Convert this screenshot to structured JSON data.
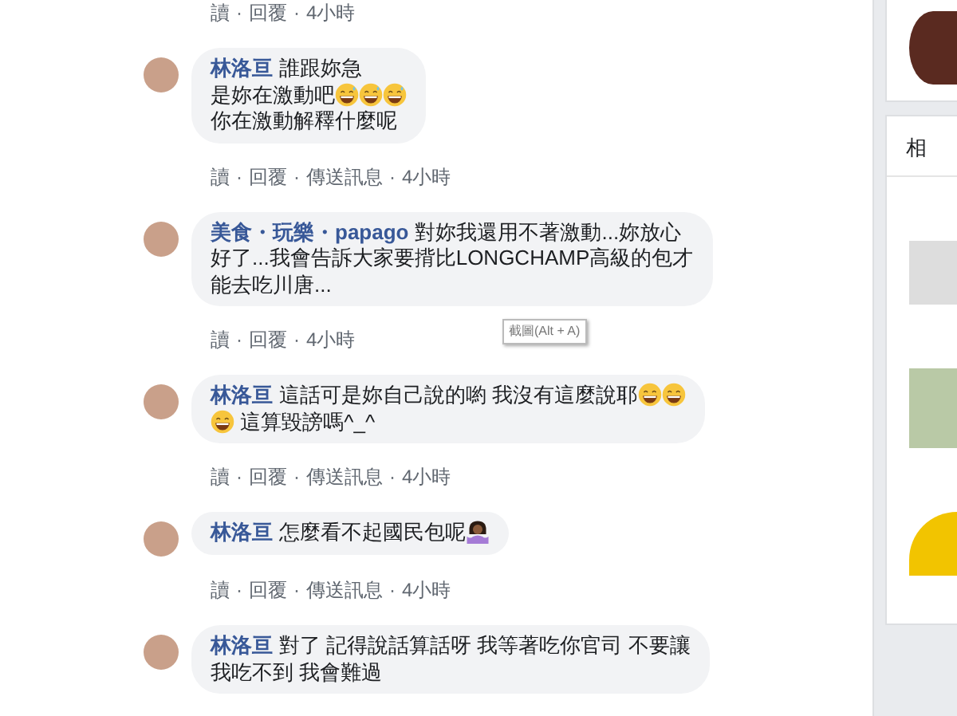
{
  "comments": [
    {
      "actions": [
        {
          "label": "讀"
        },
        {
          "label": "回覆"
        }
      ],
      "separator": "·",
      "time": "4小時"
    },
    {
      "author": "林洛亘",
      "parts": [
        {
          "kind": "text",
          "text": "誰跟妳急"
        },
        {
          "kind": "break"
        },
        {
          "kind": "text",
          "text": "是妳在激動吧"
        },
        {
          "kind": "laugh-emoji"
        },
        {
          "kind": "laugh-emoji"
        },
        {
          "kind": "laugh-emoji"
        },
        {
          "kind": "break"
        },
        {
          "kind": "text",
          "text": "你在激動解釋什麼呢"
        }
      ],
      "actions": [
        {
          "label": "讀"
        },
        {
          "label": "回覆"
        },
        {
          "label": "傳送訊息"
        }
      ],
      "separator": "·",
      "time": "4小時"
    },
    {
      "author": "美食・玩樂・papago",
      "parts": [
        {
          "kind": "text",
          "text": "對妳我還用不著激動...妳放心"
        },
        {
          "kind": "break"
        },
        {
          "kind": "text",
          "text": "好了...我會告訴大家要揹比LONGCHAMP高級的包才"
        },
        {
          "kind": "break"
        },
        {
          "kind": "text",
          "text": "能去吃川唐..."
        }
      ],
      "actions": [
        {
          "label": "讀"
        },
        {
          "label": "回覆"
        }
      ],
      "separator": "·",
      "time": "4小時",
      "tooltip": "截圖(Alt + A)"
    },
    {
      "author": "林洛亘",
      "parts": [
        {
          "kind": "text",
          "text": "這話可是妳自己說的喲 我沒有這麼說耶"
        },
        {
          "kind": "grin-emoji"
        },
        {
          "kind": "grin-emoji"
        },
        {
          "kind": "break"
        },
        {
          "kind": "grin-emoji"
        },
        {
          "kind": "text",
          "text": " 這算毀謗嗎^_^"
        }
      ],
      "actions": [
        {
          "label": "讀"
        },
        {
          "label": "回覆"
        },
        {
          "label": "傳送訊息"
        }
      ],
      "separator": "·",
      "time": "4小時"
    },
    {
      "author": "林洛亘",
      "parts": [
        {
          "kind": "text",
          "text": "怎麼看不起國民包呢"
        },
        {
          "kind": "shrug-emoji"
        }
      ],
      "actions": [
        {
          "label": "讀"
        },
        {
          "label": "回覆"
        },
        {
          "label": "傳送訊息"
        }
      ],
      "separator": "·",
      "time": "4小時"
    },
    {
      "author": "林洛亘",
      "parts": [
        {
          "kind": "text",
          "text": "對了 記得說話算話呀 我等著吃你官司 不要讓"
        },
        {
          "kind": "break"
        },
        {
          "kind": "text",
          "text": "我吃不到 我會難過"
        }
      ]
    }
  ],
  "sidebar": {
    "card_title": "相"
  }
}
